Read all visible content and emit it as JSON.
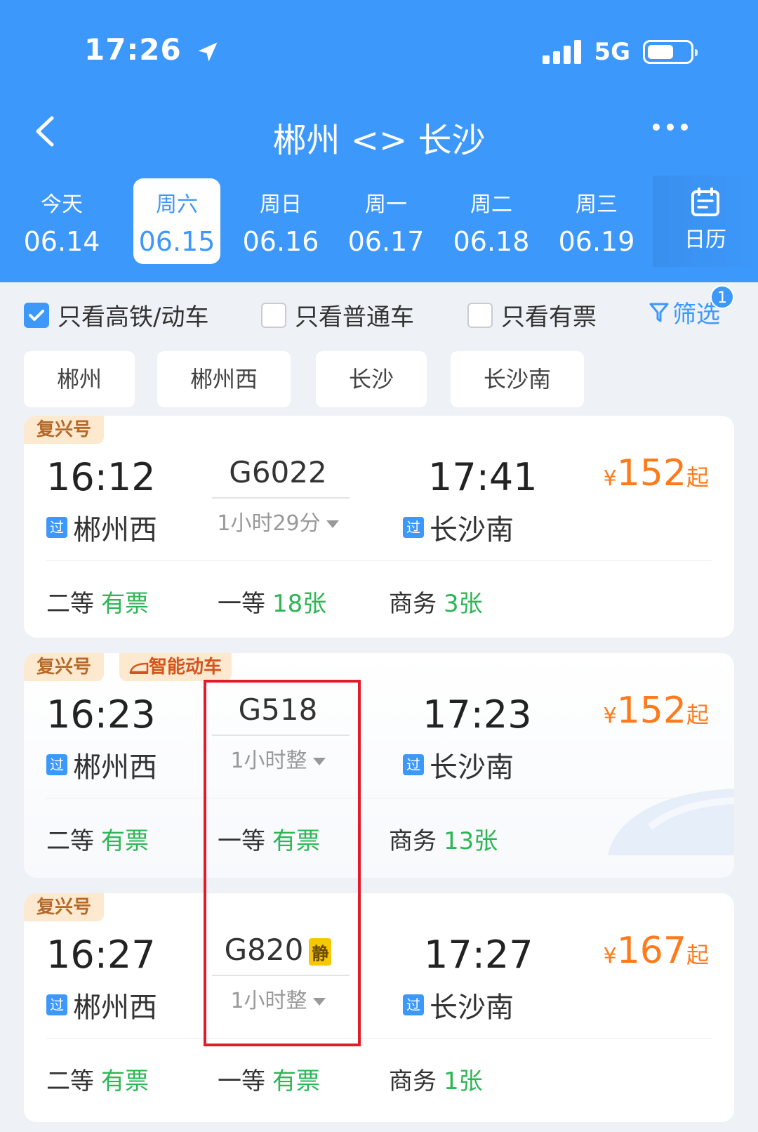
{
  "status": {
    "time": "17:26",
    "network": "5G"
  },
  "header": {
    "title": "郴州 <> 长沙"
  },
  "dates": [
    {
      "week": "今天",
      "date": "06.14",
      "active": false
    },
    {
      "week": "周六",
      "date": "06.15",
      "active": true
    },
    {
      "week": "周日",
      "date": "06.16",
      "active": false
    },
    {
      "week": "周一",
      "date": "06.17",
      "active": false
    },
    {
      "week": "周二",
      "date": "06.18",
      "active": false
    },
    {
      "week": "周三",
      "date": "06.19",
      "active": false
    }
  ],
  "calendar_label": "日历",
  "filters": {
    "high_speed": {
      "label": "只看高铁/动车",
      "checked": true
    },
    "normal": {
      "label": "只看普通车",
      "checked": false
    },
    "available": {
      "label": "只看有票",
      "checked": false
    },
    "screen_label": "筛选",
    "screen_badge": "1"
  },
  "stations": [
    "郴州",
    "郴州西",
    "长沙",
    "长沙南"
  ],
  "trains": [
    {
      "tag": "复兴号",
      "tag2": "",
      "dep_time": "16:12",
      "dep_station": "郴州西",
      "pass_mark": "过",
      "train_no": "G6022",
      "quiet": "",
      "duration": "1小时29分",
      "arr_time": "17:41",
      "arr_station": "长沙南",
      "currency": "¥",
      "price": "152",
      "price_suffix": "起",
      "seats": [
        {
          "cls": "二等",
          "val": "有票"
        },
        {
          "cls": "一等",
          "val": "18张"
        },
        {
          "cls": "商务",
          "val": "3张"
        }
      ]
    },
    {
      "tag": "复兴号",
      "tag2": "智能动车",
      "dep_time": "16:23",
      "dep_station": "郴州西",
      "pass_mark": "过",
      "train_no": "G518",
      "quiet": "",
      "duration": "1小时整",
      "arr_time": "17:23",
      "arr_station": "长沙南",
      "currency": "¥",
      "price": "152",
      "price_suffix": "起",
      "seats": [
        {
          "cls": "二等",
          "val": "有票"
        },
        {
          "cls": "一等",
          "val": "有票"
        },
        {
          "cls": "商务",
          "val": "13张"
        }
      ]
    },
    {
      "tag": "复兴号",
      "tag2": "",
      "dep_time": "16:27",
      "dep_station": "郴州西",
      "pass_mark": "过",
      "train_no": "G820",
      "quiet": "静",
      "duration": "1小时整",
      "arr_time": "17:27",
      "arr_station": "长沙南",
      "currency": "¥",
      "price": "167",
      "price_suffix": "起",
      "seats": [
        {
          "cls": "二等",
          "val": "有票"
        },
        {
          "cls": "一等",
          "val": "有票"
        },
        {
          "cls": "商务",
          "val": "1张"
        }
      ]
    }
  ],
  "colors": {
    "primary": "#3d98fb",
    "price": "#ff7a1a",
    "available": "#2db655",
    "highlight": "#e01c2a"
  }
}
